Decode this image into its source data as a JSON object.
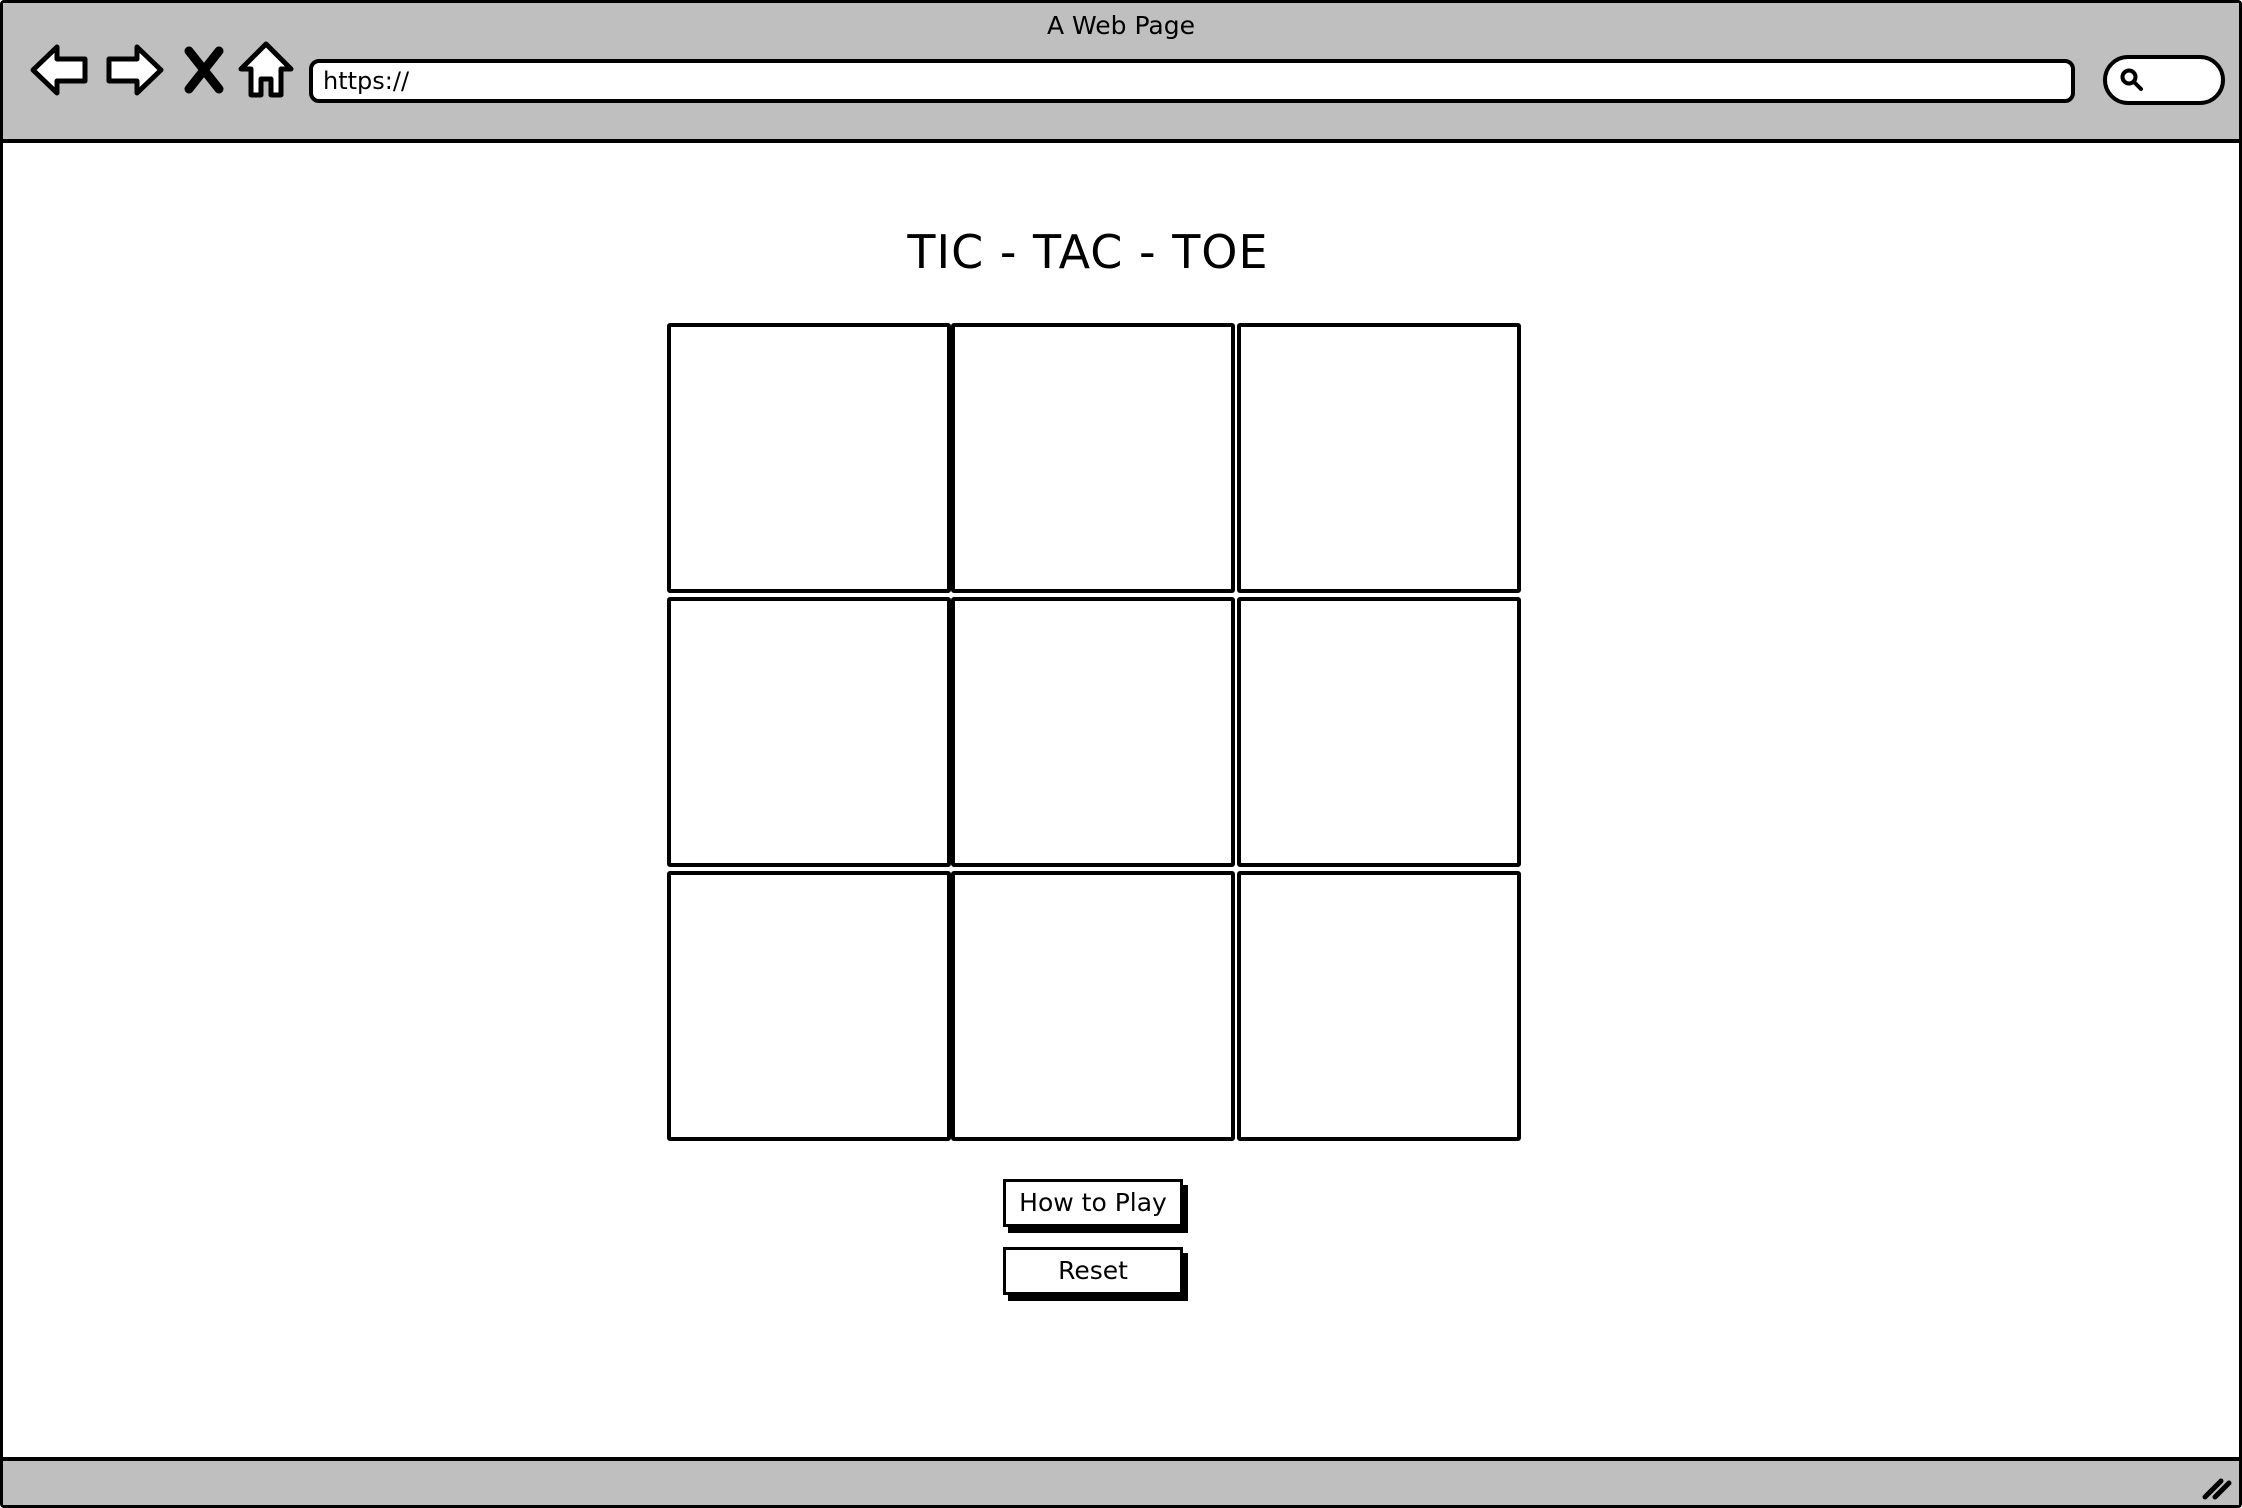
{
  "window": {
    "title": "A Web Page"
  },
  "toolbar": {
    "back_icon": "arrow-left-icon",
    "forward_icon": "arrow-right-icon",
    "stop_icon": "close-icon",
    "home_icon": "home-icon",
    "address_value": "https://",
    "search_icon": "search-icon"
  },
  "game": {
    "title": "TIC - TAC - TOE",
    "cells": [
      "",
      "",
      "",
      "",
      "",
      "",
      "",
      "",
      ""
    ]
  },
  "buttons": {
    "how_to_play": "How to Play",
    "reset": "Reset"
  },
  "status_bar": {
    "resize_icon": "resize-grip-icon"
  }
}
